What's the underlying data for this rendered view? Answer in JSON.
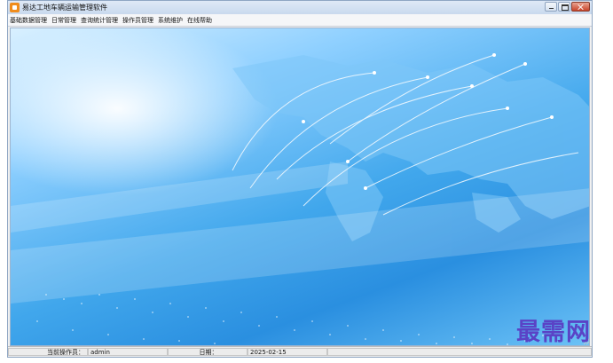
{
  "window": {
    "title": "易达工地车辆运输管理软件"
  },
  "menu": {
    "items": [
      "基础数据管理",
      "日常管理",
      "查询统计管理",
      "操作员管理",
      "系统维护",
      "在线帮助"
    ]
  },
  "status_bar": {
    "operator_label": "当前操作员：",
    "operator_value": "admin",
    "date_label": "日期：",
    "date_value": "2025-02-15"
  },
  "watermark": "最需网",
  "colors": {
    "background_blue": "#2a8fe0",
    "highlight": "#ffffff",
    "watermark": "#5a43c6"
  },
  "icons": {
    "app": "app-logo-icon",
    "minimize": "minimize-icon",
    "maximize": "maximize-icon",
    "close": "close-icon"
  }
}
